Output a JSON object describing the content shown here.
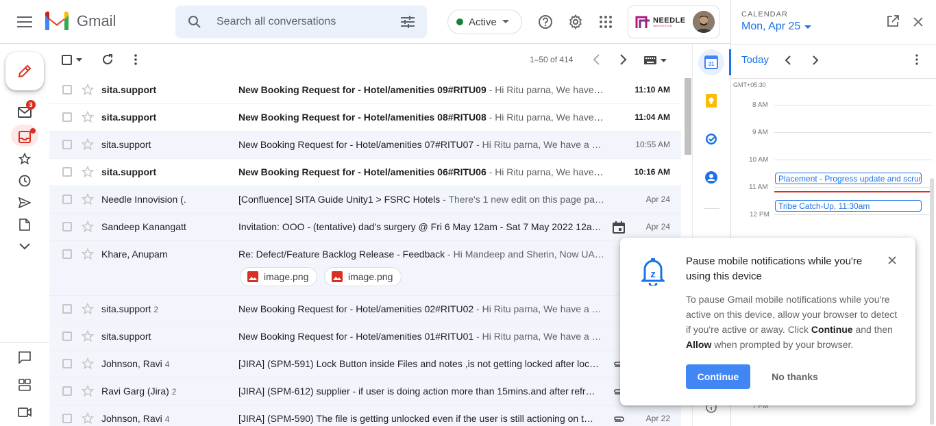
{
  "header": {
    "app_name": "Gmail",
    "search_placeholder": "Search all conversations",
    "status_label": "Active",
    "account_brand": "NEEDLE",
    "account_brand_sub": "INNOVISION"
  },
  "rail": {
    "mail_badge": "3"
  },
  "toolbar": {
    "pagination": "1–50 of 414"
  },
  "emails": [
    {
      "sender": "sita.support",
      "count": "",
      "subject": "New Booking Request for - Hotel/amenities 09#RITU09",
      "snippet": " - Hi Ritu parna, We have a…",
      "date": "11:10 AM",
      "unread": true
    },
    {
      "sender": "sita.support",
      "count": "",
      "subject": "New Booking Request for - Hotel/amenities 08#RITU08",
      "snippet": " - Hi Ritu parna, We have a…",
      "date": "11:04 AM",
      "unread": true
    },
    {
      "sender": "sita.support",
      "count": "",
      "subject": "New Booking Request for - Hotel/amenities 07#RITU07",
      "snippet": " - Hi Ritu parna, We have a …",
      "date": "10:55 AM",
      "unread": false
    },
    {
      "sender": "sita.support",
      "count": "",
      "subject": "New Booking Request for - Hotel/amenities 06#RITU06",
      "snippet": " - Hi Ritu parna, We have a…",
      "date": "10:16 AM",
      "unread": true
    },
    {
      "sender": "Needle Innovision (.",
      "count": "",
      "subject": "[Confluence] SITA Guide Unity1 > FSRC Hotels",
      "snippet": " - There's 1 new edit on this page pa…",
      "date": "Apr 24",
      "unread": false
    },
    {
      "sender": "Sandeep Kanangatt",
      "count": "",
      "subject": "Invitation: OOO - (tentative) dad's surgery @ Fri 6 May 12am - Sat 7 May 2022 12a…",
      "snippet": "",
      "date": "Apr 24",
      "unread": false,
      "icon": "calendar-icon"
    },
    {
      "sender": "Khare, Anupam",
      "count": "",
      "subject": "Re: Defect/Feature Backlog Release - Feedback",
      "snippet": " - Hi Mandeep and Sherin, Now UA…",
      "date": "",
      "unread": false,
      "attachments": [
        "image.png",
        "image.png"
      ]
    },
    {
      "sender": "sita.support",
      "count": "2",
      "subject": "New Booking Request for - Hotel/amenities 02#RITU02",
      "snippet": " - Hi Ritu parna, We have a …",
      "date": "",
      "unread": false
    },
    {
      "sender": "sita.support",
      "count": "",
      "subject": "New Booking Request for - Hotel/amenities 01#RITU01",
      "snippet": " - Hi Ritu parna, We have a …",
      "date": "",
      "unread": false
    },
    {
      "sender": "Johnson, Ravi",
      "count": "4",
      "subject": "[JIRA] (SPM-591) Lock Button inside Files and notes ,is not getting locked after loc…",
      "snippet": "",
      "date": "",
      "unread": false,
      "icon": "attachment-icon"
    },
    {
      "sender": "Ravi Garg (Jira)",
      "count": "2",
      "subject": "[JIRA] (SPM-612) supplier - if user is doing action more than 15mins.and after refr…",
      "snippet": "",
      "date": "",
      "unread": false,
      "icon": "attachment-icon"
    },
    {
      "sender": "Johnson, Ravi",
      "count": "4",
      "subject": "[JIRA] (SPM-590) The file is getting unlocked even if the user is still actioning on t…",
      "snippet": "",
      "date": "Apr 22",
      "unread": false,
      "icon": "attachment-icon"
    }
  ],
  "calendar": {
    "label": "CALENDAR",
    "date": "Mon, Apr 25",
    "today_label": "Today",
    "timezone": "GMT+05:30",
    "hours": [
      "8 AM",
      "9 AM",
      "10 AM",
      "11 AM",
      "12 PM",
      "7 PM"
    ],
    "events": [
      {
        "title": "Placement - Progress update and scrum",
        "time": ""
      },
      {
        "title": "Tribe Catch-Up,",
        "time": " 11:30am"
      }
    ]
  },
  "dialog": {
    "title": "Pause mobile notifications while you're using this device",
    "body_1": "To pause Gmail mobile notifications while you're active on this device, allow your browser to detect if you're active or away. Click ",
    "body_continue": "Continue",
    "body_2": " and then ",
    "body_allow": "Allow",
    "body_3": " when prompted by your browser.",
    "continue_label": "Continue",
    "nothanks_label": "No thanks"
  },
  "colors": {
    "accent": "#1a73e8",
    "danger": "#d93025",
    "search_bg": "#eaf1fb",
    "read_row_bg": "#f2f6fc"
  }
}
